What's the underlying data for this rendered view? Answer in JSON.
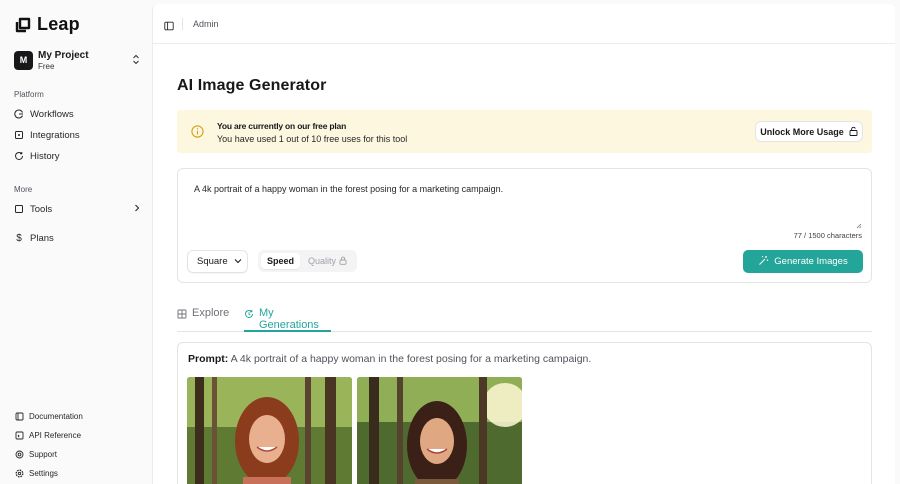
{
  "app": {
    "name": "Leap"
  },
  "project": {
    "initial": "M",
    "name": "My Project",
    "plan": "Free"
  },
  "sidebar": {
    "platform_label": "Platform",
    "platform_items": [
      {
        "label": "Workflows",
        "icon": "workflows-icon"
      },
      {
        "label": "Integrations",
        "icon": "integrations-icon"
      },
      {
        "label": "History",
        "icon": "history-icon"
      }
    ],
    "more_label": "More",
    "more_items": [
      {
        "label": "Tools",
        "icon": "tools-icon"
      },
      {
        "label": "Plans",
        "icon": "dollar-icon"
      }
    ],
    "footer_items": [
      {
        "label": "Documentation",
        "icon": "book-icon"
      },
      {
        "label": "API Reference",
        "icon": "code-icon"
      },
      {
        "label": "Support",
        "icon": "support-icon"
      },
      {
        "label": "Settings",
        "icon": "settings-icon"
      }
    ]
  },
  "topbar": {
    "breadcrumb": "Admin"
  },
  "page": {
    "title": "AI Image Generator"
  },
  "banner": {
    "title": "You are currently on our free plan",
    "subtitle": "You have used 1 out of 10 free uses for this tool",
    "button": "Unlock More Usage"
  },
  "prompt": {
    "text": "A 4k portrait of a happy woman in the forest posing for a marketing campaign.",
    "char_count": "77 / 1500 characters",
    "aspect": "Square",
    "mode_speed": "Speed",
    "mode_quality": "Quality",
    "generate_button": "Generate Images"
  },
  "tabs": {
    "explore": "Explore",
    "my_generations": "My Generations",
    "active": "my_generations"
  },
  "generations": {
    "prompt_label": "Prompt:",
    "prompt_text": "A 4k portrait of a happy woman in the forest posing for a marketing campaign."
  },
  "colors": {
    "accent": "#23a59a",
    "banner_bg": "#fdf7df",
    "banner_icon": "#d4a017"
  }
}
